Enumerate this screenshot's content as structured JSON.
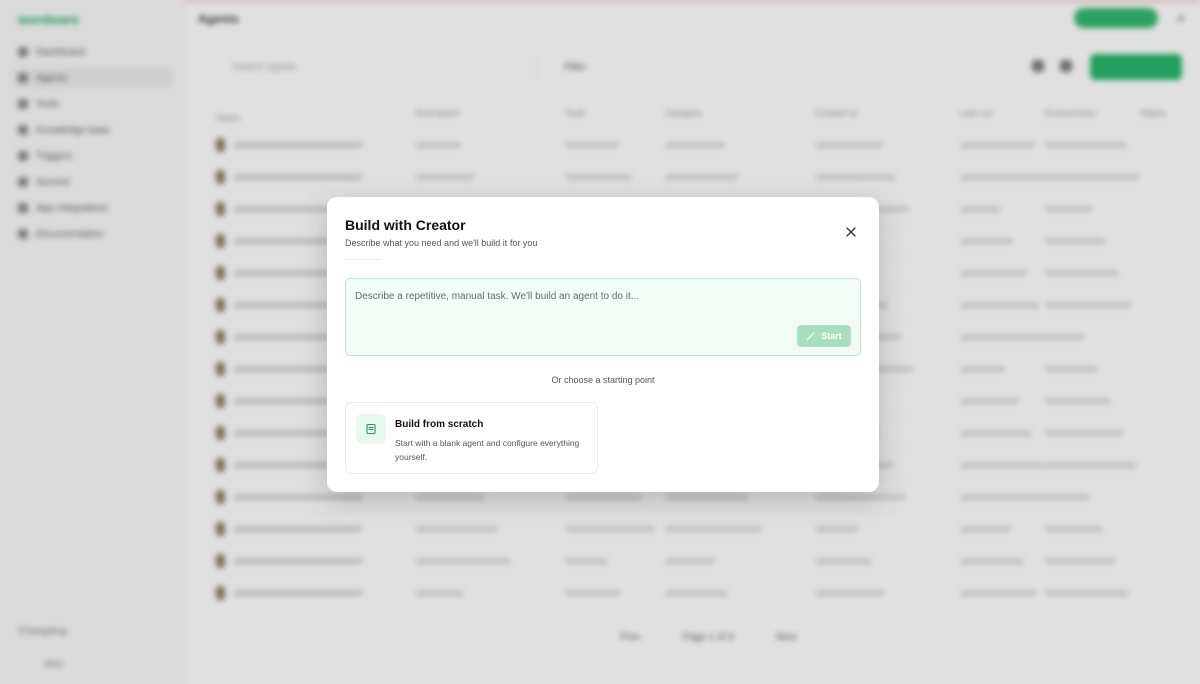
{
  "background": {
    "app_name": "wordware",
    "page_title": "Agents",
    "sidebar": {
      "items": [
        "Dashboard",
        "Agents",
        "Tools",
        "Knowledge base",
        "Triggers",
        "Secrets",
        "App integrations",
        "Documentation"
      ],
      "footer_left": "Changelog",
      "footer_user": "Alex"
    },
    "search_placeholder": "Search agents",
    "filter_label": "Filter",
    "table_headers": [
      "Name",
      "Description",
      "Tools",
      "Category",
      "Created at",
      "Last run",
      "Environment",
      "Status"
    ],
    "pager": {
      "prev": "Prev",
      "page": "Page 1 of 3",
      "next": "Next"
    }
  },
  "modal": {
    "title": "Build with Creator",
    "subtitle": "Describe what you need and we'll build it for you",
    "prompt_placeholder": "Describe a repetitive, manual task. We'll build an agent to do it...",
    "start_label": "Start",
    "or_text": "Or choose a starting point",
    "scratch": {
      "title": "Build from scratch",
      "description": "Start with a blank agent and configure everything yourself."
    }
  },
  "colors": {
    "accent_green": "#22b064",
    "prompt_border": "#b9e7cd",
    "start_disabled": "#a9dfc1"
  },
  "icons": {
    "close": "close-icon",
    "start": "magic-wand-icon",
    "scratch": "document-icon"
  }
}
